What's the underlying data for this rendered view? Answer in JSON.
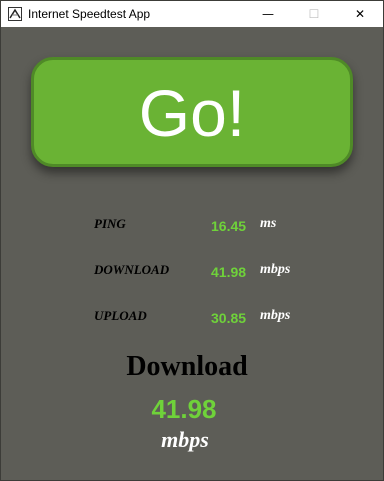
{
  "window": {
    "title": "Internet Speedtest App",
    "icon": "speedtest-app-icon",
    "minimize_glyph": "—",
    "maximize_glyph": "☐",
    "close_glyph": "✕"
  },
  "go_button": {
    "label": "Go!"
  },
  "metrics": [
    {
      "label": "PING",
      "value": "16.45",
      "unit": "ms"
    },
    {
      "label": "DOWNLOAD",
      "value": "41.98",
      "unit": "mbps"
    },
    {
      "label": "UPLOAD",
      "value": "30.85",
      "unit": "mbps"
    }
  ],
  "result": {
    "title": "Download",
    "value": "41.98",
    "unit": "mbps"
  },
  "colors": {
    "background": "#5d5d57",
    "button_green": "#6ab334",
    "value_green": "#6fd23a"
  }
}
